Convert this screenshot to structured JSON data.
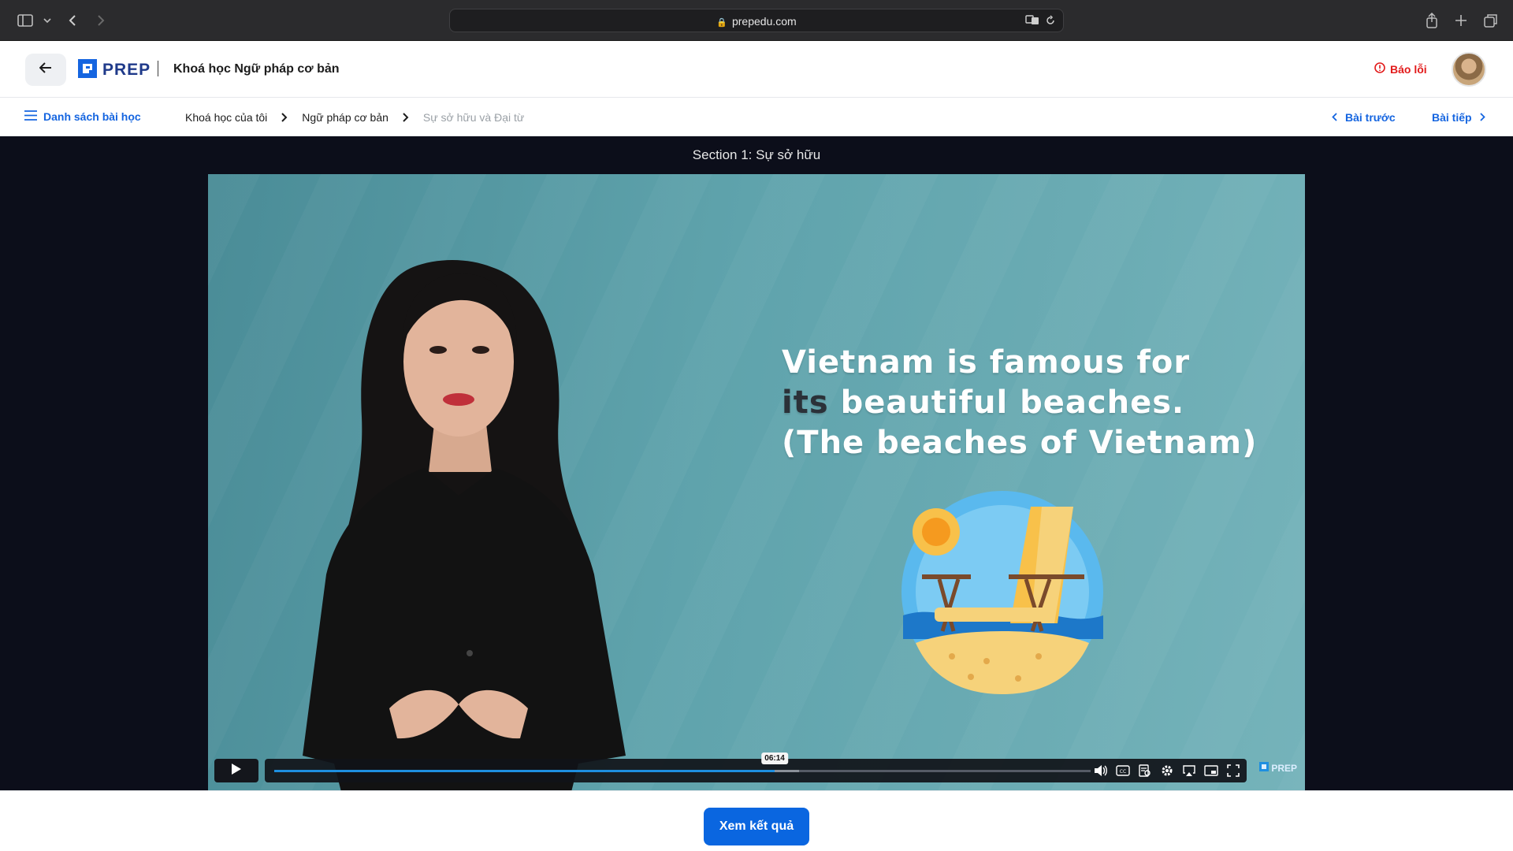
{
  "browser": {
    "url": "prepedu.com"
  },
  "header": {
    "logo_text": "PREP",
    "course_title": "Khoá học Ngữ pháp cơ bản",
    "report_label": "Báo lỗi"
  },
  "subnav": {
    "lesson_list_label": "Danh sách bài học",
    "breadcrumb": [
      "Khoá học của tôi",
      "Ngữ pháp cơ bản",
      "Sự sở hữu và Đại từ"
    ],
    "prev_label": "Bài trước",
    "next_label": "Bài tiếp"
  },
  "video": {
    "section_title": "Section 1: Sự sở hữu",
    "slide_line1": "Vietnam is famous for",
    "slide_line2_dark": "its",
    "slide_line2_rest": " beautiful beaches.",
    "slide_line3": "(The beaches of Vietnam)",
    "current_time": "06:14",
    "progress_fraction": 0.613,
    "buffered_fraction": 0.643,
    "watermark": "PREP",
    "controls": [
      "play-icon",
      "volume-icon",
      "captions-icon",
      "transcript-icon",
      "settings-icon",
      "airplay-icon",
      "pip-icon",
      "fullscreen-icon"
    ]
  },
  "footer": {
    "result_button": "Xem kết quả"
  },
  "colors": {
    "accent": "#0a66e0",
    "report": "#e21b1b",
    "stage_bg": "#0c0e1a",
    "video_bg": "#5fa3ac"
  }
}
